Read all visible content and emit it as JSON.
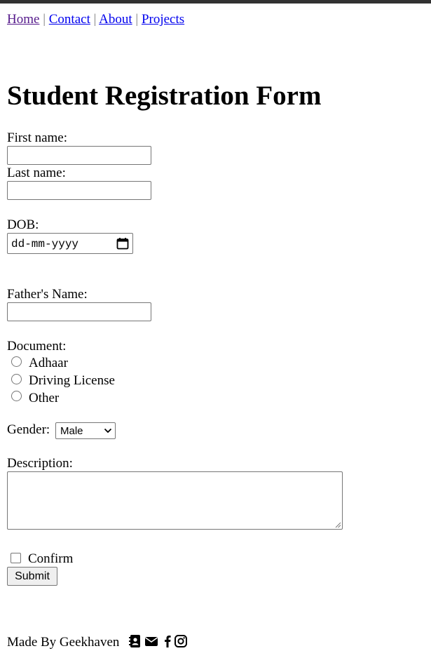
{
  "nav": {
    "links": [
      {
        "label": "Home"
      },
      {
        "label": "Contact"
      },
      {
        "label": "About"
      },
      {
        "label": "Projects"
      }
    ],
    "separator": "|"
  },
  "page_title": "Student Registration Form",
  "form": {
    "first_name": {
      "label": "First name:",
      "value": ""
    },
    "last_name": {
      "label": "Last name:",
      "value": ""
    },
    "dob": {
      "label": "DOB:",
      "placeholder": "dd-mm-yyyy"
    },
    "father_name": {
      "label": "Father's Name:",
      "value": ""
    },
    "document": {
      "label": "Document:",
      "options": [
        "Adhaar",
        "Driving License",
        "Other"
      ],
      "selected": null
    },
    "gender": {
      "label": "Gender:",
      "selected": "Male"
    },
    "description": {
      "label": "Description:",
      "value": ""
    },
    "confirm": {
      "label": "Confirm",
      "checked": false
    },
    "submit_label": "Submit"
  },
  "footer": {
    "text": "Made By Geekhaven",
    "icons": [
      "contact-book-icon",
      "envelope-icon",
      "facebook-icon",
      "instagram-icon"
    ]
  }
}
